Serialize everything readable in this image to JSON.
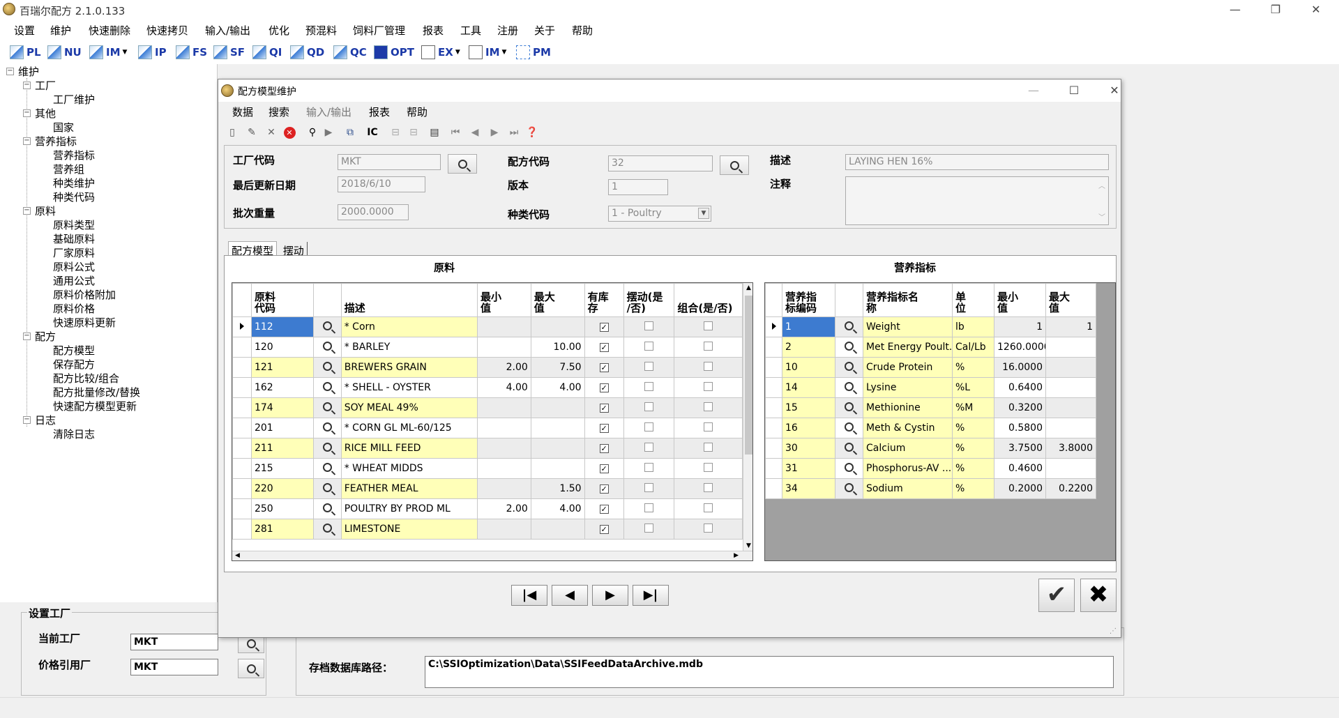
{
  "app": {
    "title": "百瑞尔配方 2.1.0.133"
  },
  "menu": [
    "设置",
    "维护",
    "快速删除",
    "快速拷贝",
    "输入/输出",
    "优化",
    "预混料",
    "饲料厂管理",
    "报表",
    "工具",
    "注册",
    "关于",
    "帮助"
  ],
  "toolbar": [
    "PL",
    "NU",
    "IM",
    "IP",
    "FS",
    "SF",
    "QI",
    "QD",
    "QC",
    "OPT",
    "EX",
    "IM",
    "PM"
  ],
  "tree": {
    "root": "维护",
    "n1": "工厂",
    "n1a": "工厂维护",
    "n2": "其他",
    "n2a": "国家",
    "n3": "营养指标",
    "n3a": "营养指标",
    "n3b": "营养组",
    "n3c": "种类维护",
    "n3d": "种类代码",
    "n4": "原料",
    "n4a": "原料类型",
    "n4b": "基础原料",
    "n4c": "厂家原料",
    "n4d": "原料公式",
    "n4e": "通用公式",
    "n4f": "原料价格附加",
    "n4g": "原料价格",
    "n4h": "快速原料更新",
    "n5": "配方",
    "n5a": "配方模型",
    "n5b": "保存配方",
    "n5c": "配方比较/组合",
    "n5d": "配方批量修改/替换",
    "n5e": "快速配方模型更新",
    "n6": "日志",
    "n6a": "清除日志"
  },
  "settings": {
    "group": "设置工厂",
    "current_label": "当前工厂",
    "current_value": "MKT",
    "price_label": "价格引用厂",
    "price_value": "MKT"
  },
  "archive": {
    "label": "存档数据库路径：",
    "value": "C:\\SSIOptimization\\Data\\SSIFeedDataArchive.mdb"
  },
  "dialog": {
    "title": "配方模型维护",
    "menu": [
      "数据",
      "搜索",
      "输入/输出",
      "报表",
      "帮助"
    ],
    "plant_code_label": "工厂代码",
    "plant_code": "MKT",
    "formula_code_label": "配方代码",
    "formula_code": "32",
    "desc_label": "描述",
    "desc": "LAYING HEN 16%",
    "updated_label": "最后更新日期",
    "updated": "2018/6/10",
    "version_label": "版本",
    "version": "1",
    "note_label": "注释",
    "batch_label": "批次重量",
    "batch": "2000.0000",
    "category_label": "种类代码",
    "category": "1 - Poultry",
    "tab1": "配方模型",
    "tab2": "摆动",
    "ing_title": "原料",
    "nut_title": "营养指标"
  },
  "ingredients": {
    "headers": [
      "原料\n代码",
      "",
      "描述",
      "最小\n值",
      "最大\n值",
      "有库\n存",
      "摆动(是\n/否)",
      "组合(是/否)"
    ],
    "rows": [
      {
        "code": "112",
        "desc": "* Corn",
        "min": "",
        "max": "",
        "stock": true
      },
      {
        "code": "120",
        "desc": "* BARLEY",
        "min": "",
        "max": "10.00",
        "stock": true
      },
      {
        "code": "121",
        "desc": "BREWERS GRAIN",
        "min": "2.00",
        "max": "7.50",
        "stock": true
      },
      {
        "code": "162",
        "desc": "* SHELL - OYSTER",
        "min": "4.00",
        "max": "4.00",
        "stock": true
      },
      {
        "code": "174",
        "desc": "SOY MEAL 49%",
        "min": "",
        "max": "",
        "stock": true
      },
      {
        "code": "201",
        "desc": "* CORN GL ML-60/125",
        "min": "",
        "max": "",
        "stock": true
      },
      {
        "code": "211",
        "desc": "RICE MILL FEED",
        "min": "",
        "max": "",
        "stock": true
      },
      {
        "code": "215",
        "desc": "* WHEAT MIDDS",
        "min": "",
        "max": "",
        "stock": true
      },
      {
        "code": "220",
        "desc": "FEATHER MEAL",
        "min": "",
        "max": "1.50",
        "stock": true
      },
      {
        "code": "250",
        "desc": "POULTRY BY PROD ML",
        "min": "2.00",
        "max": "4.00",
        "stock": true
      },
      {
        "code": "281",
        "desc": "LIMESTONE",
        "min": "",
        "max": "",
        "stock": true
      }
    ]
  },
  "nutrients": {
    "headers": [
      "营养指\n标编码",
      "",
      "营养指标名\n称",
      "单\n位",
      "最小\n值",
      "最大\n值"
    ],
    "rows": [
      {
        "code": "1",
        "name": "Weight",
        "unit": "lb",
        "min": "1",
        "max": "1"
      },
      {
        "code": "2",
        "name": "Met Energy Poult...",
        "unit": "Cal/Lb",
        "min": "1260.0000",
        "max": ""
      },
      {
        "code": "10",
        "name": "Crude Protein",
        "unit": "%",
        "min": "16.0000",
        "max": ""
      },
      {
        "code": "14",
        "name": "Lysine",
        "unit": "%L",
        "min": "0.6400",
        "max": ""
      },
      {
        "code": "15",
        "name": "Methionine",
        "unit": "%M",
        "min": "0.3200",
        "max": ""
      },
      {
        "code": "16",
        "name": "Meth & Cystin",
        "unit": "%",
        "min": "0.5800",
        "max": ""
      },
      {
        "code": "30",
        "name": "Calcium",
        "unit": "%",
        "min": "3.7500",
        "max": "3.8000"
      },
      {
        "code": "31",
        "name": "Phosphorus-AV ...",
        "unit": "%",
        "min": "0.4600",
        "max": ""
      },
      {
        "code": "34",
        "name": "Sodium",
        "unit": "%",
        "min": "0.2000",
        "max": "0.2200"
      }
    ]
  }
}
